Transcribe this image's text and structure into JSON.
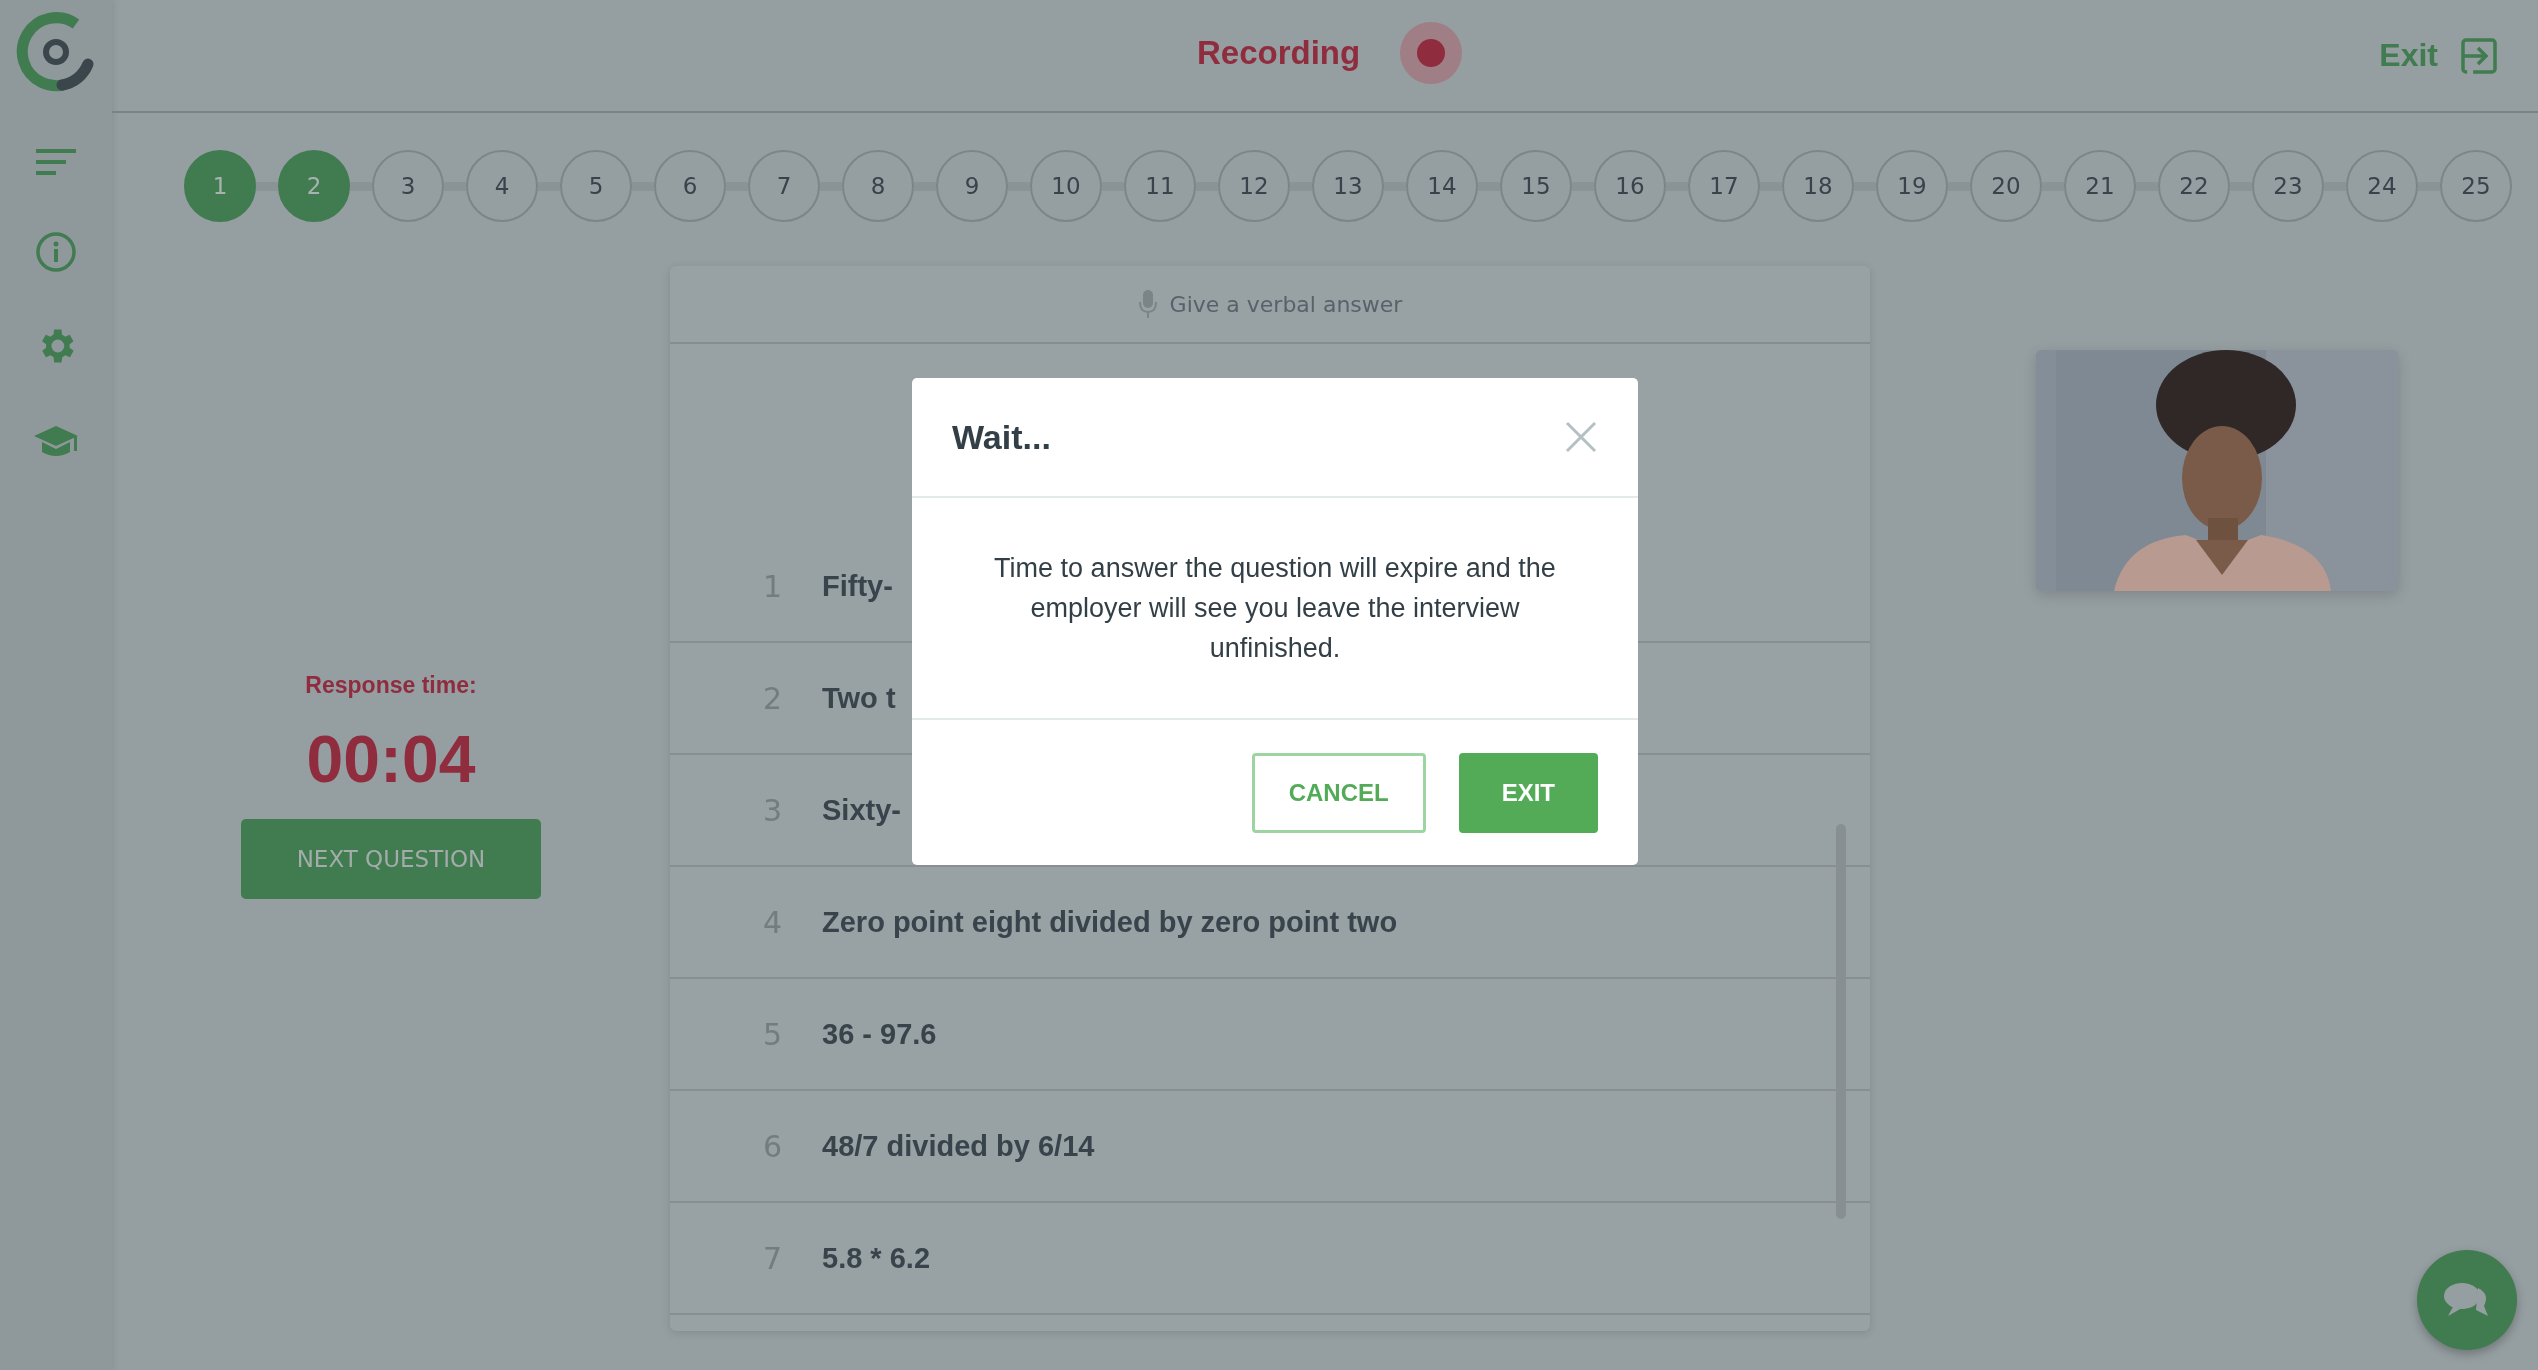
{
  "header": {
    "recording_label": "Recording",
    "recording": true,
    "exit_label": "Exit"
  },
  "steps": [
    {
      "label": "1",
      "done": true
    },
    {
      "label": "2",
      "done": true
    },
    {
      "label": "3",
      "done": false
    },
    {
      "label": "4",
      "done": false
    },
    {
      "label": "5",
      "done": false
    },
    {
      "label": "6",
      "done": false
    },
    {
      "label": "7",
      "done": false
    },
    {
      "label": "8",
      "done": false
    },
    {
      "label": "9",
      "done": false
    },
    {
      "label": "10",
      "done": false
    },
    {
      "label": "11",
      "done": false
    },
    {
      "label": "12",
      "done": false
    },
    {
      "label": "13",
      "done": false
    },
    {
      "label": "14",
      "done": false
    },
    {
      "label": "15",
      "done": false
    },
    {
      "label": "16",
      "done": false
    },
    {
      "label": "17",
      "done": false
    },
    {
      "label": "18",
      "done": false
    },
    {
      "label": "19",
      "done": false
    },
    {
      "label": "20",
      "done": false
    },
    {
      "label": "21",
      "done": false
    },
    {
      "label": "22",
      "done": false
    },
    {
      "label": "23",
      "done": false
    },
    {
      "label": "24",
      "done": false
    },
    {
      "label": "25",
      "done": false
    }
  ],
  "timer": {
    "label": "Response time:",
    "value": "00:04",
    "button": "NEXT QUESTION"
  },
  "card": {
    "mode": "Give a verbal answer",
    "questions": [
      {
        "number": "1",
        "text": "Fifty-"
      },
      {
        "number": "2",
        "text": "Two t"
      },
      {
        "number": "3",
        "text": "Sixty-"
      },
      {
        "number": "4",
        "text": "Zero point eight divided by zero point two"
      },
      {
        "number": "5",
        "text": "36 - 97.6"
      },
      {
        "number": "6",
        "text": "48/7 divided by 6/14"
      },
      {
        "number": "7",
        "text": "5.8 * 6.2"
      }
    ]
  },
  "dialog": {
    "title": "Wait...",
    "message": "Time to answer the question will expire and the employer will see you leave the interview unfinished.",
    "buttons": [
      {
        "label": "CANCEL",
        "kind": "outline"
      },
      {
        "label": "EXIT",
        "kind": "primary"
      }
    ]
  }
}
